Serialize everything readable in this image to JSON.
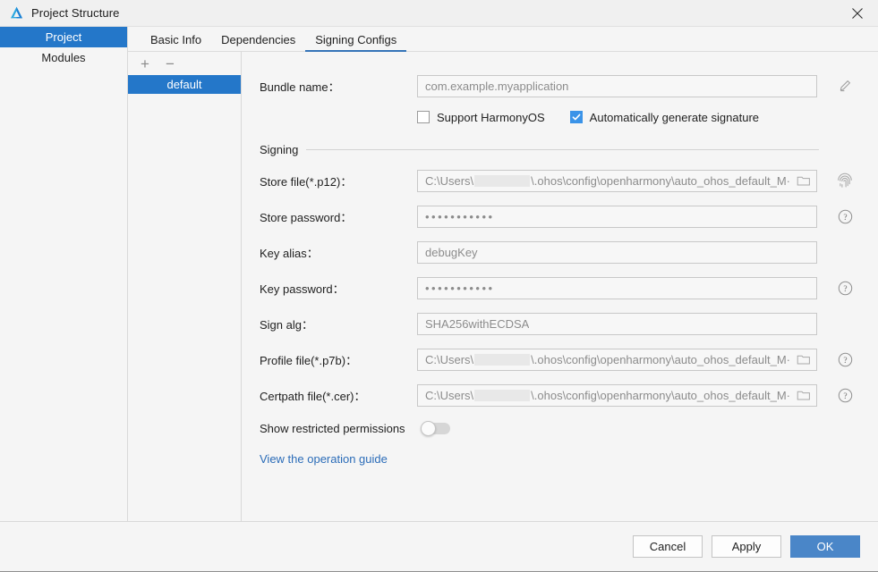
{
  "window": {
    "title": "Project Structure",
    "logo_icon": "deveco-logo-icon",
    "close_icon": "close-icon"
  },
  "sidebar": {
    "items": [
      {
        "label": "Project",
        "active": true
      },
      {
        "label": "Modules",
        "active": false
      }
    ]
  },
  "tabs": [
    {
      "label": "Basic Info",
      "active": false
    },
    {
      "label": "Dependencies",
      "active": false
    },
    {
      "label": "Signing Configs",
      "active": true
    }
  ],
  "config_list": {
    "add_label": "+",
    "remove_label": "−",
    "items": [
      {
        "label": "default",
        "active": true
      }
    ]
  },
  "form": {
    "bundle_name": {
      "label": "Bundle name：",
      "value": "com.example.myapplication",
      "edit_icon": "pencil-edit-icon"
    },
    "checkboxes": [
      {
        "label": "Support HarmonyOS",
        "checked": false
      },
      {
        "label": "Automatically generate signature",
        "checked": true
      }
    ],
    "section_title": "Signing",
    "fields": [
      {
        "label": "Store file(*.p12)：",
        "type": "path",
        "prefix": "C:\\Users\\",
        "suffix": "\\.ohos\\config\\openharmony\\auto_ohos_default_M·",
        "browse_icon": "folder-icon",
        "aux_icon": "fingerprint-icon"
      },
      {
        "label": "Store password：",
        "type": "password",
        "value": "•••••••••••",
        "aux_icon": "help-icon"
      },
      {
        "label": "Key alias：",
        "type": "text",
        "value": "debugKey",
        "aux_icon": ""
      },
      {
        "label": "Key password：",
        "type": "password",
        "value": "•••••••••••",
        "aux_icon": "help-icon"
      },
      {
        "label": "Sign alg：",
        "type": "text",
        "value": "SHA256withECDSA",
        "aux_icon": ""
      },
      {
        "label": "Profile file(*.p7b)：",
        "type": "path",
        "prefix": "C:\\Users\\",
        "suffix": "\\.ohos\\config\\openharmony\\auto_ohos_default_M·",
        "browse_icon": "folder-icon",
        "aux_icon": "help-icon"
      },
      {
        "label": "Certpath file(*.cer)：",
        "type": "path",
        "prefix": "C:\\Users\\",
        "suffix": "\\.ohos\\config\\openharmony\\auto_ohos_default_M·",
        "browse_icon": "folder-icon",
        "aux_icon": "help-icon"
      }
    ],
    "restricted_permissions": {
      "label": "Show restricted permissions",
      "enabled": false
    },
    "guide_link": "View the operation guide"
  },
  "footer": {
    "cancel_label": "Cancel",
    "apply_label": "Apply",
    "ok_label": "OK"
  },
  "colors": {
    "accent_blue": "#2477c9",
    "tab_underline": "#3574b8",
    "primary_button": "#4a86c8",
    "link": "#2b6cb8",
    "checkbox_checked": "#3a93e8"
  }
}
